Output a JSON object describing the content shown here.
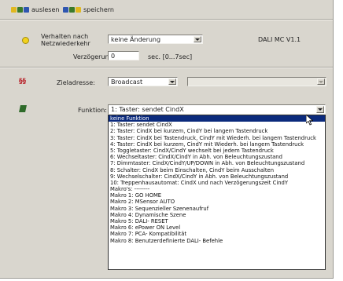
{
  "toolbar": {
    "read_label": "auslesen",
    "save_label": "speichern"
  },
  "behavior": {
    "label": "Verhalten nach\nNetzwiederkehr",
    "value": "keine Änderung",
    "version": "DALI MC V1.1",
    "delay_label": "Verzögerung:",
    "delay_value": "0",
    "delay_unit": "sec.  [0...7sec]"
  },
  "target": {
    "label": "Zieladresse:",
    "value": "Broadcast",
    "secondary_value": ""
  },
  "function": {
    "label": "Funktion:",
    "value": "1: Taster:  sendet CindX"
  },
  "colors": {
    "selection": "#0b2a7c",
    "frame": "#d9d6ce"
  },
  "function_options": [
    "keine Funktion",
    "1: Taster:  sendet CindX",
    "2: Taster:  CindX bei kurzem, CindY bei langem Tastendruck",
    "3: Taster:  CindX bei Tastendruck, CindY mit Wiederh. bei langem Tastendruck",
    "4: Taster:  CindX bei kurzem, CindY mit Wiederh. bei langem Tastendruck",
    "5: Toggletaster:  CindX/CindY wechselt bei jedem Tastendruck",
    "6: Wechseltaster:  CindX/CindY in Abh. von Beleuchtungszustand",
    "7: Dimmtaster:  CindX/CindY/UP/DOWN in Abh. von Beleuchtungszustand",
    "8: Schalter:  CindX beim Einschalten, CindY beim Ausschalten",
    "9: Wechselschalter:  CindX/CindY in Abh. von Beleuchtungszustand",
    "10: Treppenhausautomat:  CindX und nach Verzögerungszeit CindY",
    "Makro's:  --------",
    "Makro 1:  GO HOME",
    "Makro 2:  MSensor AUTO",
    "Makro 3:  Sequenzieller Szenenaufruf",
    "Makro 4:  Dynamische Szene",
    "Makro 5:  DALI- RESET",
    "Makro 6:  ePower ON Level",
    "Makro 7:  PCA- Kompatibilität",
    "Makro 8:  Benutzerdefinierte DALI- Befehle"
  ],
  "selected_option_index": 0
}
